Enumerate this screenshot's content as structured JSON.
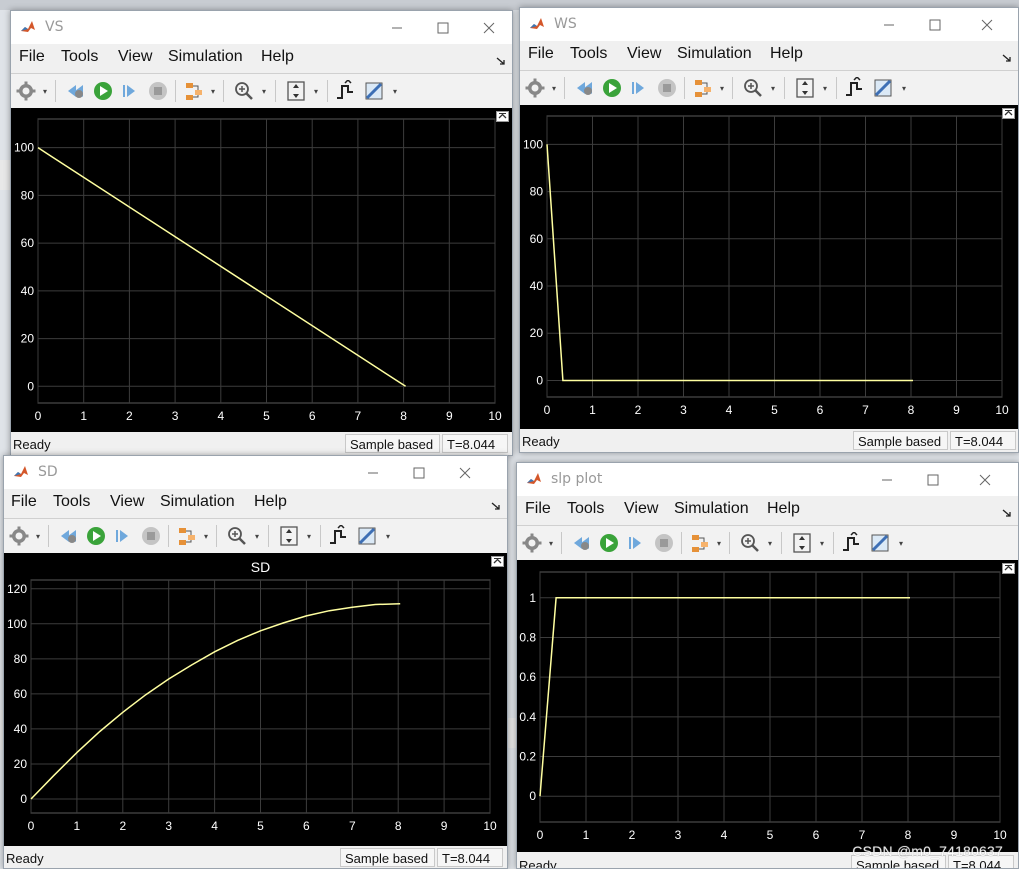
{
  "menu": [
    "File",
    "Tools",
    "View",
    "Simulation",
    "Help"
  ],
  "status": {
    "ready": "Ready",
    "mode": "Sample based",
    "time": "T=8.044"
  },
  "colors": {
    "plot_bg": "#000000",
    "grid": "#3c3c3c",
    "axis_text": "#ffffff",
    "trace": "#ffffa0"
  },
  "watermark": "CSDN @m0_74180637",
  "windows": [
    {
      "id": "vs",
      "title": "VS",
      "plot_title": "",
      "chart_data": {
        "type": "line",
        "x": [
          0,
          0.2,
          8.044
        ],
        "y": [
          100,
          97.5,
          0
        ],
        "xlim": [
          0,
          10
        ],
        "ylim": [
          -7,
          112
        ],
        "xticks": [
          0,
          1,
          2,
          3,
          4,
          5,
          6,
          7,
          8,
          9,
          10
        ],
        "yticks": [
          0,
          20,
          40,
          60,
          80,
          100
        ],
        "grid": true
      }
    },
    {
      "id": "ws",
      "title": "WS",
      "plot_title": "",
      "chart_data": {
        "type": "line",
        "x": [
          0,
          0.35,
          8.044
        ],
        "y": [
          100,
          0,
          0
        ],
        "xlim": [
          0,
          10
        ],
        "ylim": [
          -7,
          112
        ],
        "xticks": [
          0,
          1,
          2,
          3,
          4,
          5,
          6,
          7,
          8,
          9,
          10
        ],
        "yticks": [
          0,
          20,
          40,
          60,
          80,
          100
        ],
        "grid": true
      }
    },
    {
      "id": "sd",
      "title": "SD",
      "plot_title": "SD",
      "chart_data": {
        "type": "line",
        "x": [
          0,
          0.5,
          1,
          1.5,
          2,
          2.5,
          3,
          3.5,
          4,
          4.5,
          5,
          5.5,
          6,
          6.5,
          7,
          7.5,
          8.044
        ],
        "y": [
          0,
          13.5,
          26.5,
          38.5,
          49.5,
          59.5,
          68.5,
          76.5,
          84,
          90.5,
          96,
          100.5,
          104.5,
          107.5,
          109.5,
          111,
          111.4
        ],
        "xlim": [
          0,
          10
        ],
        "ylim": [
          -8,
          125
        ],
        "xticks": [
          0,
          1,
          2,
          3,
          4,
          5,
          6,
          7,
          8,
          9,
          10
        ],
        "yticks": [
          0,
          20,
          40,
          60,
          80,
          100,
          120
        ],
        "grid": true
      }
    },
    {
      "id": "slp",
      "title": "slp plot",
      "plot_title": "",
      "chart_data": {
        "type": "line",
        "x": [
          0,
          0.35,
          8.044
        ],
        "y": [
          0,
          1,
          1
        ],
        "xlim": [
          0,
          10
        ],
        "ylim": [
          -0.13,
          1.13
        ],
        "xticks": [
          0,
          1,
          2,
          3,
          4,
          5,
          6,
          7,
          8,
          9,
          10
        ],
        "yticks": [
          0,
          0.2,
          0.4,
          0.6,
          0.8,
          1
        ],
        "grid": true
      }
    }
  ]
}
